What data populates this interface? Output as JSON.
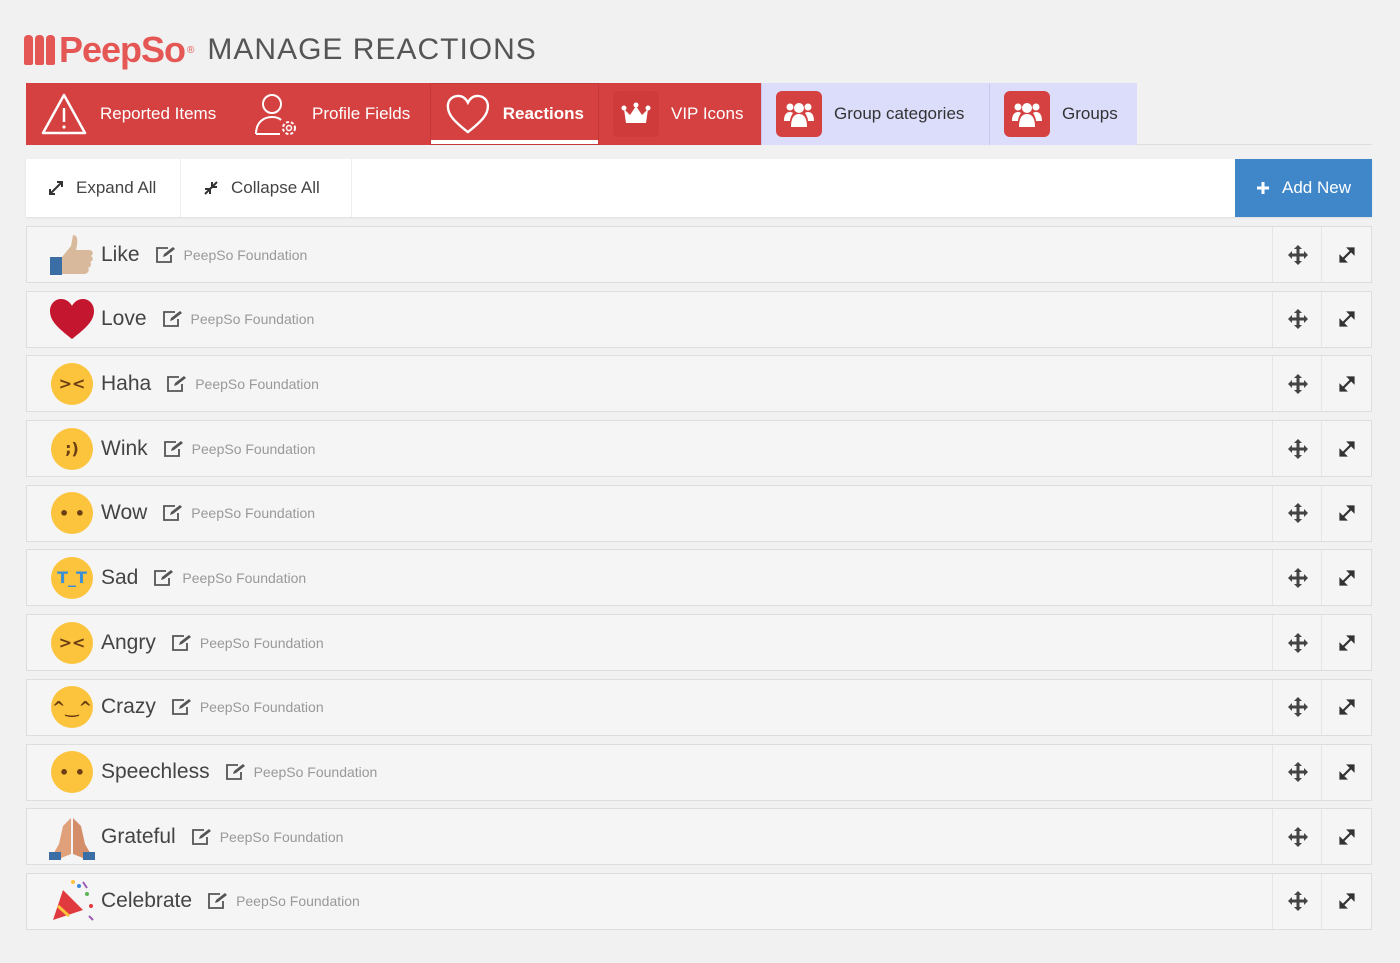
{
  "header": {
    "logo": "PeepSo",
    "title": "MANAGE REACTIONS"
  },
  "tabs": [
    {
      "label": "Reported Items",
      "icon": "warning-icon"
    },
    {
      "label": "Profile Fields",
      "icon": "user-gear-icon"
    },
    {
      "label": "Reactions",
      "icon": "heart-outline-icon",
      "active": true
    },
    {
      "label": "VIP Icons",
      "icon": "crown-icon"
    },
    {
      "label": "Group categories",
      "icon": "group-icon"
    },
    {
      "label": "Groups",
      "icon": "group-icon"
    }
  ],
  "toolbar": {
    "expand_all": "Expand All",
    "collapse_all": "Collapse All",
    "add_new": "Add New"
  },
  "reactions": [
    {
      "name": "Like",
      "author": "PeepSo Foundation",
      "icon": "thumbs-up"
    },
    {
      "name": "Love",
      "author": "PeepSo Foundation",
      "icon": "heart"
    },
    {
      "name": "Haha",
      "author": "PeepSo Foundation",
      "icon": "laughing-face"
    },
    {
      "name": "Wink",
      "author": "PeepSo Foundation",
      "icon": "winking-face"
    },
    {
      "name": "Wow",
      "author": "PeepSo Foundation",
      "icon": "surprised-face"
    },
    {
      "name": "Sad",
      "author": "PeepSo Foundation",
      "icon": "crying-face"
    },
    {
      "name": "Angry",
      "author": "PeepSo Foundation",
      "icon": "angry-face"
    },
    {
      "name": "Crazy",
      "author": "PeepSo Foundation",
      "icon": "tongue-face"
    },
    {
      "name": "Speechless",
      "author": "PeepSo Foundation",
      "icon": "no-mouth-face"
    },
    {
      "name": "Grateful",
      "author": "PeepSo Foundation",
      "icon": "praying-hands"
    },
    {
      "name": "Celebrate",
      "author": "PeepSo Foundation",
      "icon": "party-popper"
    }
  ],
  "colors": {
    "brand": "#d44140",
    "accent": "#3f87c9",
    "tab_inactive": "#dcdcfb"
  }
}
